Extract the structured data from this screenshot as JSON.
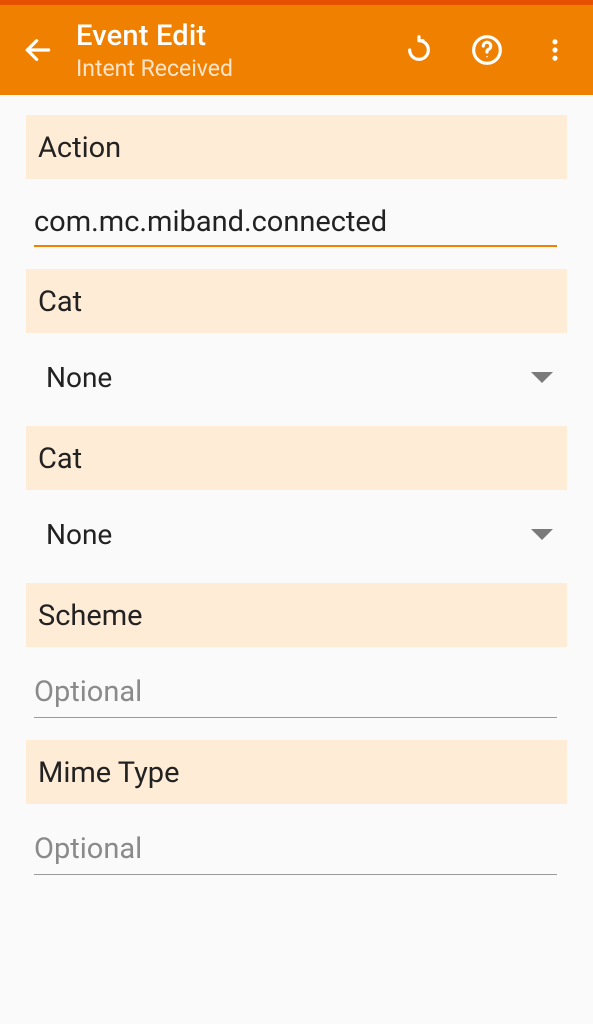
{
  "appbar": {
    "title": "Event Edit",
    "subtitle": "Intent Received"
  },
  "sections": {
    "action": {
      "label": "Action",
      "value": "com.mc.miband.connected"
    },
    "cat1": {
      "label": "Cat",
      "selected": "None"
    },
    "cat2": {
      "label": "Cat",
      "selected": "None"
    },
    "scheme": {
      "label": "Scheme",
      "placeholder": "Optional",
      "value": ""
    },
    "mimetype": {
      "label": "Mime Type",
      "placeholder": "Optional",
      "value": ""
    }
  }
}
